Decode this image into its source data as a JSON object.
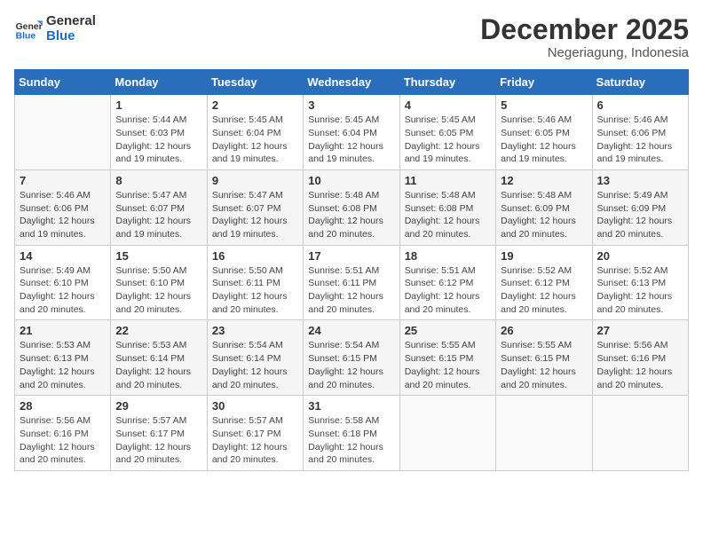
{
  "header": {
    "logo_line1": "General",
    "logo_line2": "Blue",
    "month": "December 2025",
    "location": "Negeriagung, Indonesia"
  },
  "weekdays": [
    "Sunday",
    "Monday",
    "Tuesday",
    "Wednesday",
    "Thursday",
    "Friday",
    "Saturday"
  ],
  "weeks": [
    [
      {
        "day": "",
        "info": ""
      },
      {
        "day": "1",
        "info": "Sunrise: 5:44 AM\nSunset: 6:03 PM\nDaylight: 12 hours\nand 19 minutes."
      },
      {
        "day": "2",
        "info": "Sunrise: 5:45 AM\nSunset: 6:04 PM\nDaylight: 12 hours\nand 19 minutes."
      },
      {
        "day": "3",
        "info": "Sunrise: 5:45 AM\nSunset: 6:04 PM\nDaylight: 12 hours\nand 19 minutes."
      },
      {
        "day": "4",
        "info": "Sunrise: 5:45 AM\nSunset: 6:05 PM\nDaylight: 12 hours\nand 19 minutes."
      },
      {
        "day": "5",
        "info": "Sunrise: 5:46 AM\nSunset: 6:05 PM\nDaylight: 12 hours\nand 19 minutes."
      },
      {
        "day": "6",
        "info": "Sunrise: 5:46 AM\nSunset: 6:06 PM\nDaylight: 12 hours\nand 19 minutes."
      }
    ],
    [
      {
        "day": "7",
        "info": "Sunrise: 5:46 AM\nSunset: 6:06 PM\nDaylight: 12 hours\nand 19 minutes."
      },
      {
        "day": "8",
        "info": "Sunrise: 5:47 AM\nSunset: 6:07 PM\nDaylight: 12 hours\nand 19 minutes."
      },
      {
        "day": "9",
        "info": "Sunrise: 5:47 AM\nSunset: 6:07 PM\nDaylight: 12 hours\nand 19 minutes."
      },
      {
        "day": "10",
        "info": "Sunrise: 5:48 AM\nSunset: 6:08 PM\nDaylight: 12 hours\nand 20 minutes."
      },
      {
        "day": "11",
        "info": "Sunrise: 5:48 AM\nSunset: 6:08 PM\nDaylight: 12 hours\nand 20 minutes."
      },
      {
        "day": "12",
        "info": "Sunrise: 5:48 AM\nSunset: 6:09 PM\nDaylight: 12 hours\nand 20 minutes."
      },
      {
        "day": "13",
        "info": "Sunrise: 5:49 AM\nSunset: 6:09 PM\nDaylight: 12 hours\nand 20 minutes."
      }
    ],
    [
      {
        "day": "14",
        "info": "Sunrise: 5:49 AM\nSunset: 6:10 PM\nDaylight: 12 hours\nand 20 minutes."
      },
      {
        "day": "15",
        "info": "Sunrise: 5:50 AM\nSunset: 6:10 PM\nDaylight: 12 hours\nand 20 minutes."
      },
      {
        "day": "16",
        "info": "Sunrise: 5:50 AM\nSunset: 6:11 PM\nDaylight: 12 hours\nand 20 minutes."
      },
      {
        "day": "17",
        "info": "Sunrise: 5:51 AM\nSunset: 6:11 PM\nDaylight: 12 hours\nand 20 minutes."
      },
      {
        "day": "18",
        "info": "Sunrise: 5:51 AM\nSunset: 6:12 PM\nDaylight: 12 hours\nand 20 minutes."
      },
      {
        "day": "19",
        "info": "Sunrise: 5:52 AM\nSunset: 6:12 PM\nDaylight: 12 hours\nand 20 minutes."
      },
      {
        "day": "20",
        "info": "Sunrise: 5:52 AM\nSunset: 6:13 PM\nDaylight: 12 hours\nand 20 minutes."
      }
    ],
    [
      {
        "day": "21",
        "info": "Sunrise: 5:53 AM\nSunset: 6:13 PM\nDaylight: 12 hours\nand 20 minutes."
      },
      {
        "day": "22",
        "info": "Sunrise: 5:53 AM\nSunset: 6:14 PM\nDaylight: 12 hours\nand 20 minutes."
      },
      {
        "day": "23",
        "info": "Sunrise: 5:54 AM\nSunset: 6:14 PM\nDaylight: 12 hours\nand 20 minutes."
      },
      {
        "day": "24",
        "info": "Sunrise: 5:54 AM\nSunset: 6:15 PM\nDaylight: 12 hours\nand 20 minutes."
      },
      {
        "day": "25",
        "info": "Sunrise: 5:55 AM\nSunset: 6:15 PM\nDaylight: 12 hours\nand 20 minutes."
      },
      {
        "day": "26",
        "info": "Sunrise: 5:55 AM\nSunset: 6:15 PM\nDaylight: 12 hours\nand 20 minutes."
      },
      {
        "day": "27",
        "info": "Sunrise: 5:56 AM\nSunset: 6:16 PM\nDaylight: 12 hours\nand 20 minutes."
      }
    ],
    [
      {
        "day": "28",
        "info": "Sunrise: 5:56 AM\nSunset: 6:16 PM\nDaylight: 12 hours\nand 20 minutes."
      },
      {
        "day": "29",
        "info": "Sunrise: 5:57 AM\nSunset: 6:17 PM\nDaylight: 12 hours\nand 20 minutes."
      },
      {
        "day": "30",
        "info": "Sunrise: 5:57 AM\nSunset: 6:17 PM\nDaylight: 12 hours\nand 20 minutes."
      },
      {
        "day": "31",
        "info": "Sunrise: 5:58 AM\nSunset: 6:18 PM\nDaylight: 12 hours\nand 20 minutes."
      },
      {
        "day": "",
        "info": ""
      },
      {
        "day": "",
        "info": ""
      },
      {
        "day": "",
        "info": ""
      }
    ]
  ]
}
